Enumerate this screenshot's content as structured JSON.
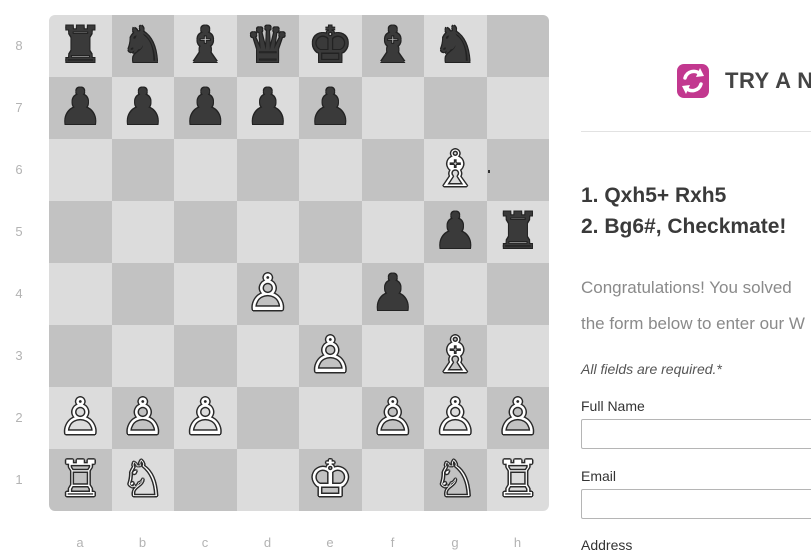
{
  "board": {
    "ranks": [
      "8",
      "7",
      "6",
      "5",
      "4",
      "3",
      "2",
      "1"
    ],
    "files": [
      "a",
      "b",
      "c",
      "d",
      "e",
      "f",
      "g",
      "h"
    ],
    "squares": [
      [
        "♜",
        "♞",
        "♝",
        "♛",
        "♚",
        "♝",
        "♞",
        ""
      ],
      [
        "♟",
        "♟",
        "♟",
        "♟",
        "♟",
        "",
        "",
        ""
      ],
      [
        "",
        "",
        "",
        "",
        "",
        "",
        "♗",
        ""
      ],
      [
        "",
        "",
        "",
        "",
        "",
        "",
        "♟",
        "♜"
      ],
      [
        "",
        "",
        "",
        "♙",
        "",
        "♟",
        "",
        ""
      ],
      [
        "",
        "",
        "",
        "",
        "♙",
        "",
        "♗",
        ""
      ],
      [
        "♙",
        "♙",
        "♙",
        "",
        "",
        "♙",
        "♙",
        "♙"
      ],
      [
        "♖",
        "♘",
        "",
        "",
        "♔",
        "",
        "♘",
        "♖"
      ]
    ],
    "colors": [
      [
        "b",
        "b",
        "b",
        "b",
        "b",
        "b",
        "b",
        ""
      ],
      [
        "b",
        "b",
        "b",
        "b",
        "b",
        "",
        "",
        ""
      ],
      [
        "",
        "",
        "",
        "",
        "",
        "",
        "w",
        ""
      ],
      [
        "",
        "",
        "",
        "",
        "",
        "",
        "b",
        "b"
      ],
      [
        "",
        "",
        "",
        "w",
        "",
        "b",
        "",
        ""
      ],
      [
        "",
        "",
        "",
        "",
        "w",
        "",
        "w",
        ""
      ],
      [
        "w",
        "w",
        "w",
        "",
        "",
        "w",
        "w",
        "w"
      ],
      [
        "w",
        "w",
        "",
        "",
        "w",
        "",
        "w",
        "w"
      ]
    ]
  },
  "brand": {
    "icon": "refresh-icon",
    "text": "TRY A N",
    "accent_color": "#c2388f"
  },
  "solution": {
    "move1": "1. Qxh5+ Rxh5",
    "move2": "2. Bg6#, Checkmate!"
  },
  "message": {
    "line1": "Congratulations! You solved",
    "line2": "the form below to enter our W"
  },
  "form": {
    "required_note": "All fields are required.*",
    "full_name_label": "Full Name",
    "full_name_value": "",
    "email_label": "Email",
    "email_value": "",
    "address_label": "Address"
  }
}
